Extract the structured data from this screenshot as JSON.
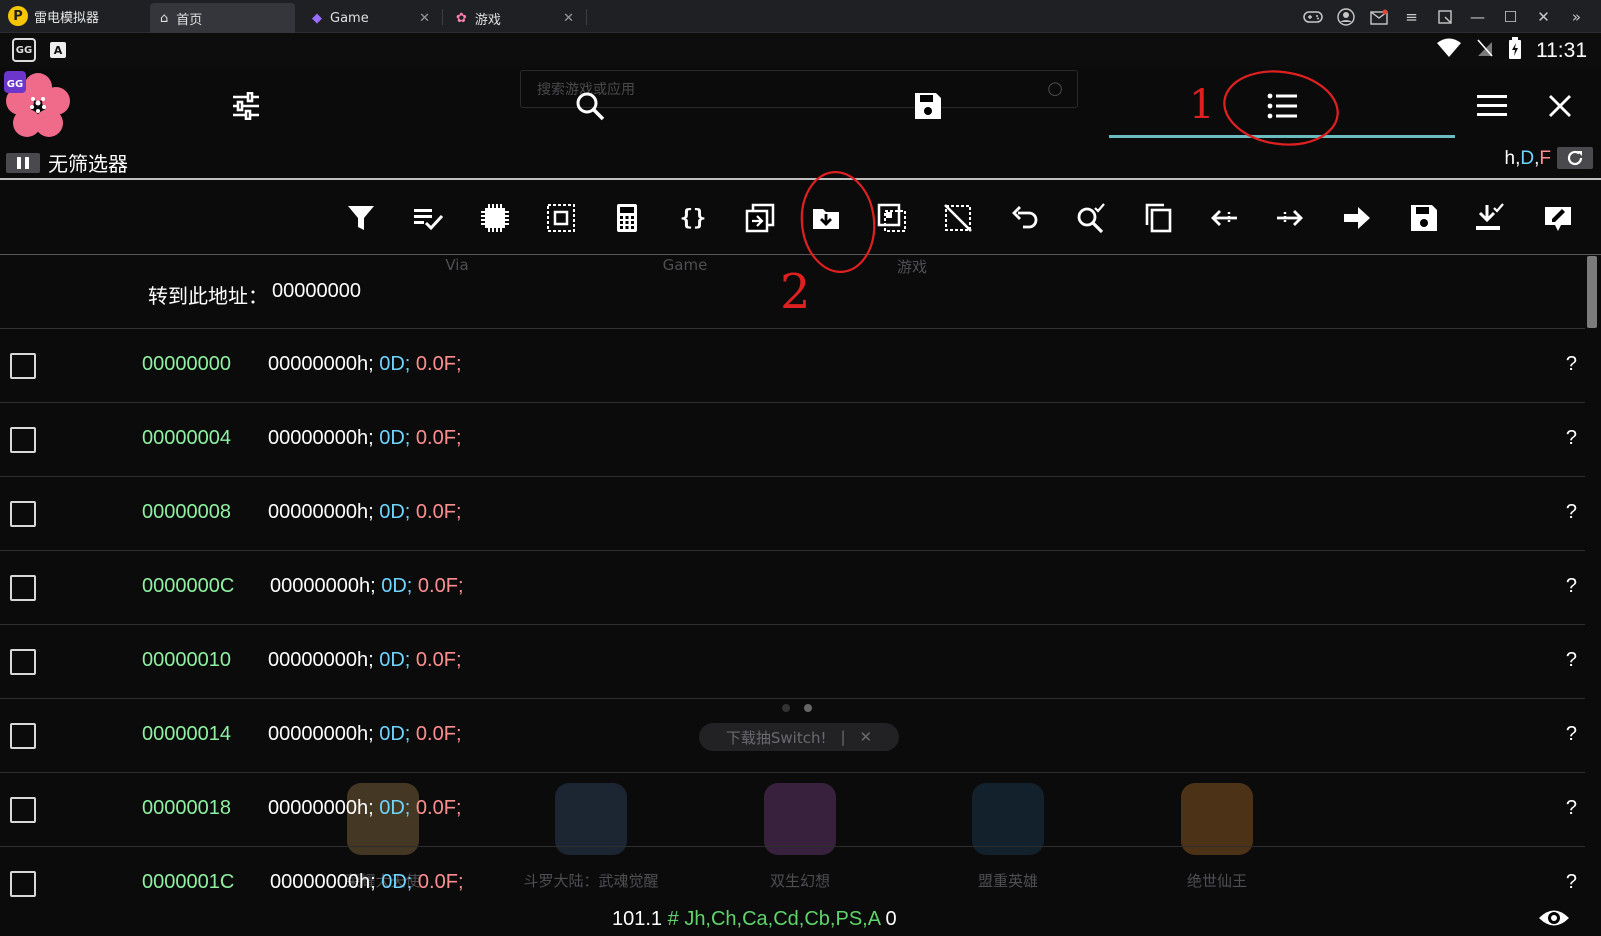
{
  "emulator": {
    "app_name": "雷电模拟器",
    "tabs": [
      {
        "label": "首页",
        "icon": "home-icon"
      },
      {
        "label": "Game",
        "icon": "game-icon"
      },
      {
        "label": "游戏",
        "icon": "flower-icon"
      }
    ],
    "window_controls": [
      "gamepad-icon",
      "account-icon",
      "mail-icon",
      "menu-icon",
      "pin-icon",
      "minimize-icon",
      "maximize-icon",
      "close-icon",
      "collapse-icon"
    ]
  },
  "status_bar": {
    "gg_icon": "GG",
    "a_icon": "A",
    "time": "11:31"
  },
  "launcher_background": {
    "search_placeholder": "搜索游戏或应用",
    "apps_top": [
      "Via",
      "Game",
      "游戏"
    ],
    "banner": "下载抽Switch!",
    "banner_sep": "|",
    "apps_bottom": [
      "荣耀大天使",
      "斗罗大陆：武魂觉醒",
      "双生幻想",
      "盟重英雄",
      "绝世仙王"
    ],
    "app_colors": [
      "#b08a50",
      "#3a5a7a",
      "#8a4a9a",
      "#1f4a6a",
      "#c77a2a"
    ]
  },
  "gg_header": {
    "filter_label": "无筛选器",
    "type_flags": {
      "h": "h",
      "sep1": ",",
      "d": "D",
      "sep2": ",",
      "f": "F"
    },
    "buttons": [
      "settings-sliders-icon",
      "search-icon",
      "save-icon",
      "list-icon",
      "hamburger-menu-icon",
      "close-icon"
    ],
    "active_tab": "list"
  },
  "toolbar": {
    "tools": [
      "filter-icon",
      "select-all-check-icon",
      "memory-chip-icon",
      "select-region-icon",
      "calculator-icon",
      "hex-braces-icon",
      "copy-to-search-icon",
      "load-folder-icon",
      "dotted-select-icon",
      "deselect-icon",
      "undo-icon",
      "search-check-icon",
      "copy-icon",
      "arrow-left-icon",
      "arrow-right-icon",
      "arrow-forward-icon",
      "save-file-icon",
      "download-check-icon",
      "edit-check-icon"
    ]
  },
  "goto": {
    "label": "转到此地址：",
    "value": "00000000"
  },
  "rows": [
    {
      "addr": "00000000",
      "hex": "00000000h;",
      "dword": "0D;",
      "float": "0.0F;",
      "q": "?"
    },
    {
      "addr": "00000004",
      "hex": "00000000h;",
      "dword": "0D;",
      "float": "0.0F;",
      "q": "?"
    },
    {
      "addr": "00000008",
      "hex": "00000000h;",
      "dword": "0D;",
      "float": "0.0F;",
      "q": "?"
    },
    {
      "addr": "0000000C",
      "hex": "00000000h;",
      "dword": "0D;",
      "float": "0.0F;",
      "q": "?"
    },
    {
      "addr": "00000010",
      "hex": "00000000h;",
      "dword": "0D;",
      "float": "0.0F;",
      "q": "?"
    },
    {
      "addr": "00000014",
      "hex": "00000000h;",
      "dword": "0D;",
      "float": "0.0F;",
      "q": "?"
    },
    {
      "addr": "00000018",
      "hex": "00000000h;",
      "dword": "0D;",
      "float": "0.0F;",
      "q": "?"
    },
    {
      "addr": "0000001C",
      "hex": "00000000h;",
      "dword": "0D;",
      "float": "0.0F;",
      "q": "?"
    }
  ],
  "bottom_status": {
    "version": "101.1",
    "hash": "#",
    "flags": "Jh,Ch,Ca,Cd,Cb,PS,A",
    "count": "0"
  },
  "annotations": {
    "label_1": "1",
    "label_2": "2"
  },
  "colors": {
    "address": "#8ef0a0",
    "dword": "#6fd6ff",
    "float": "#ff8f8f",
    "accent_underline": "#6bbcc0",
    "annotation": "#e02020"
  }
}
